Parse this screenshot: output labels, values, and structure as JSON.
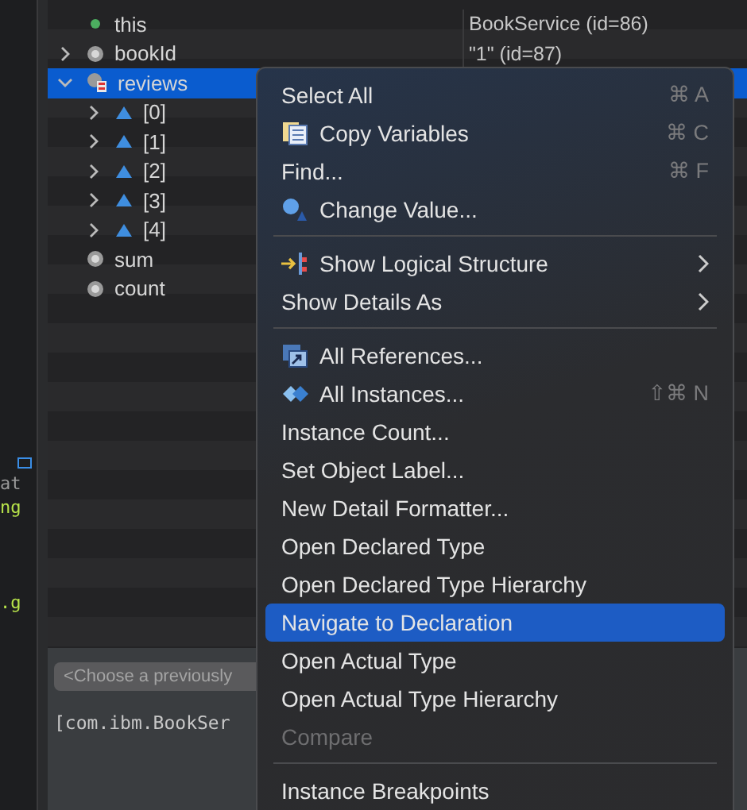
{
  "editor": {
    "fragments": [
      {
        "text": "at",
        "kind": "plain"
      },
      {
        "text": "ng",
        "kind": "string"
      },
      {
        "text": ".g",
        "kind": "string"
      }
    ]
  },
  "variables": {
    "rows": [
      {
        "label": "this",
        "value": "BookService  (id=86)",
        "kind": "this",
        "selected": false
      },
      {
        "label": "bookId",
        "value": "\"1\" (id=87)",
        "kind": "local",
        "expanded": false,
        "selected": false
      },
      {
        "label": "reviews",
        "kind": "array",
        "expanded": true,
        "selected": true,
        "children": [
          {
            "label": "[0]",
            "kind": "element",
            "expanded": false,
            "selected": false
          },
          {
            "label": "[1]",
            "kind": "element",
            "expanded": false,
            "selected": false
          },
          {
            "label": "[2]",
            "kind": "element",
            "expanded": false,
            "selected": false
          },
          {
            "label": "[3]",
            "kind": "element",
            "expanded": false,
            "selected": false
          },
          {
            "label": "[4]",
            "kind": "element",
            "expanded": false,
            "selected": false
          }
        ]
      },
      {
        "label": "sum",
        "kind": "local",
        "selected": false
      },
      {
        "label": "count",
        "kind": "local",
        "selected": false
      }
    ]
  },
  "detail": {
    "combo": "<Choose a previously",
    "text": "[com.ibm.BookSer"
  },
  "menu": {
    "sections": [
      [
        {
          "label": "Select All",
          "shortcut": "⌘ A",
          "selected": false,
          "disabled": false
        },
        {
          "label": "Copy Variables",
          "kind": "copy",
          "shortcut": "⌘ C",
          "selected": false,
          "disabled": false
        },
        {
          "label": "Find...",
          "shortcut": "⌘ F",
          "selected": false,
          "disabled": false
        },
        {
          "label": "Change Value...",
          "kind": "change",
          "selected": false,
          "disabled": false
        }
      ],
      [
        {
          "label": "Show Logical Structure",
          "kind": "logical",
          "submenu": true,
          "selected": false,
          "disabled": false
        },
        {
          "label": "Show Details As",
          "submenu": true,
          "selected": false,
          "disabled": false
        }
      ],
      [
        {
          "label": "All References...",
          "kind": "references",
          "selected": false,
          "disabled": false
        },
        {
          "label": "All Instances...",
          "kind": "instances",
          "shortcut": "⇧⌘ N",
          "selected": false,
          "disabled": false
        },
        {
          "label": "Instance Count...",
          "selected": false,
          "disabled": false
        },
        {
          "label": "Set Object Label...",
          "selected": false,
          "disabled": false
        },
        {
          "label": "New Detail Formatter...",
          "selected": false,
          "disabled": false
        },
        {
          "label": "Open Declared Type",
          "selected": false,
          "disabled": false
        },
        {
          "label": "Open Declared Type Hierarchy",
          "selected": false,
          "disabled": false
        },
        {
          "label": "Navigate to Declaration",
          "selected": true,
          "disabled": false
        },
        {
          "label": "Open Actual Type",
          "selected": false,
          "disabled": false
        },
        {
          "label": "Open Actual Type Hierarchy",
          "selected": false,
          "disabled": false
        },
        {
          "label": "Compare",
          "selected": false,
          "disabled": true
        }
      ],
      [
        {
          "label": "Instance Breakpoints",
          "selected": false,
          "disabled": false
        }
      ]
    ]
  }
}
